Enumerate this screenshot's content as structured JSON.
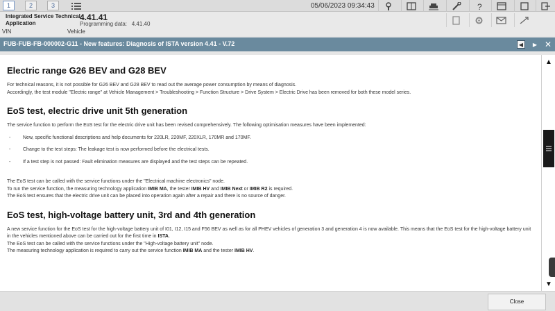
{
  "topbar": {
    "tabs": [
      "1",
      "2",
      "3"
    ],
    "list_icon": "list-icon",
    "datetime": "05/06/2023 09:34:43",
    "tools": [
      "key-icon",
      "book-icon",
      "car-lift-icon",
      "wrench-icon",
      "help-icon",
      "window-icon",
      "exit-icon"
    ]
  },
  "header": {
    "app_name": "Integrated Service Technical Application",
    "version": "4.41.41",
    "programming_label": "Programming data:",
    "programming_value": "4.41.40",
    "tools": [
      "document-icon",
      "settings-icon",
      "mail-icon",
      "resize-icon"
    ]
  },
  "vinrow": {
    "vin_label": "VIN",
    "vehicle_label": "Vehicle"
  },
  "titlebar": {
    "title": "FUB-FUB-FB-000002-G11 - New features: Diagnosis of ISTA version 4.41 - V.72",
    "prev_icon": "previous-icon",
    "next_icon": "next-icon",
    "close_icon": "close-icon"
  },
  "doc": {
    "s1": {
      "heading": "Electric range G26 BEV and G28 BEV",
      "p1": "For technical reasons, it is not possible for G26 BEV and G28 BEV to read out the average power consumption by means of diagnosis.",
      "p2": "Accordingly, the test module \"Electric range\" at Vehicle Management > Troubleshooting > Function Structure > Drive System > Electric Drive has been removed for both these model series."
    },
    "s2": {
      "heading": "EoS test, electric drive unit 5th generation",
      "intro": "The service function to perform the EoS test for the electric drive unit has been revised comprehensively. The following optimisation measures have been implemented:",
      "bullets": [
        "New, specific functional descriptions and help documents for 220LR, 220MF, 220XLR, 170MR and 170MF.",
        "Change to the test steps: The leakage test is now performed before the electrical tests.",
        "If a test step is not passed: Fault elimination measures are displayed and the test steps can be repeated."
      ],
      "p_called": "The EoS test can be called with the service functions under the \"Electrical machine electronics\" node.",
      "run_a": "To run the service function, the measuring technology application ",
      "run_b1": "IMIB MA",
      "run_c": ", the tester ",
      "run_b2": "IMIB HV",
      "run_d": " and ",
      "run_b3": "IMIB Next",
      "run_e": " or ",
      "run_b4": "IMIB R2",
      "run_f": " is required.",
      "p_ensures": "The EoS test ensures that the electric drive unit can be placed into operation again after a repair and there is no source of danger."
    },
    "s3": {
      "heading": "EoS test, high-voltage battery unit, 3rd and 4th generation",
      "p1a": "A new service function for the EoS test for the high-voltage battery unit of I01, I12, I15 and F56 BEV as well as for all PHEV vehicles of generation 3 and generation 4 is now available. This means that the EoS test for the high-voltage battery unit in the vehicles mentioned above can be carried out for the first time in ",
      "p1b": "ISTA",
      "p1c": ".",
      "p2": "The EoS test can be called with the service functions under the \"High-voltage battery unit\" node.",
      "p3a": "The measuring technology application is required to carry out the service function ",
      "p3b": "IMIB MA",
      "p3c": " and the tester ",
      "p3d": "IMIB HV",
      "p3e": "."
    }
  },
  "scroll": {
    "up_icon": "scroll-up-icon",
    "down_icon": "scroll-down-icon",
    "thumb_icon": "grip-icon"
  },
  "footer": {
    "close_label": "Close"
  }
}
